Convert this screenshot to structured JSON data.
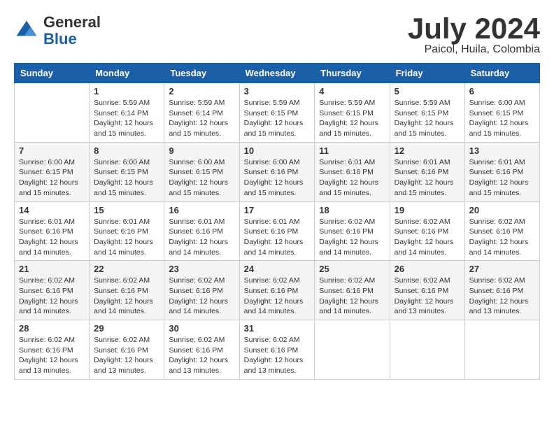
{
  "header": {
    "logo_general": "General",
    "logo_blue": "Blue",
    "title": "July 2024",
    "location": "Paicol, Huila, Colombia"
  },
  "weekdays": [
    "Sunday",
    "Monday",
    "Tuesday",
    "Wednesday",
    "Thursday",
    "Friday",
    "Saturday"
  ],
  "weeks": [
    [
      {
        "day": "",
        "sunrise": "",
        "sunset": "",
        "daylight": ""
      },
      {
        "day": "1",
        "sunrise": "Sunrise: 5:59 AM",
        "sunset": "Sunset: 6:14 PM",
        "daylight": "Daylight: 12 hours and 15 minutes."
      },
      {
        "day": "2",
        "sunrise": "Sunrise: 5:59 AM",
        "sunset": "Sunset: 6:14 PM",
        "daylight": "Daylight: 12 hours and 15 minutes."
      },
      {
        "day": "3",
        "sunrise": "Sunrise: 5:59 AM",
        "sunset": "Sunset: 6:15 PM",
        "daylight": "Daylight: 12 hours and 15 minutes."
      },
      {
        "day": "4",
        "sunrise": "Sunrise: 5:59 AM",
        "sunset": "Sunset: 6:15 PM",
        "daylight": "Daylight: 12 hours and 15 minutes."
      },
      {
        "day": "5",
        "sunrise": "Sunrise: 5:59 AM",
        "sunset": "Sunset: 6:15 PM",
        "daylight": "Daylight: 12 hours and 15 minutes."
      },
      {
        "day": "6",
        "sunrise": "Sunrise: 6:00 AM",
        "sunset": "Sunset: 6:15 PM",
        "daylight": "Daylight: 12 hours and 15 minutes."
      }
    ],
    [
      {
        "day": "7",
        "sunrise": "Sunrise: 6:00 AM",
        "sunset": "Sunset: 6:15 PM",
        "daylight": "Daylight: 12 hours and 15 minutes."
      },
      {
        "day": "8",
        "sunrise": "Sunrise: 6:00 AM",
        "sunset": "Sunset: 6:15 PM",
        "daylight": "Daylight: 12 hours and 15 minutes."
      },
      {
        "day": "9",
        "sunrise": "Sunrise: 6:00 AM",
        "sunset": "Sunset: 6:15 PM",
        "daylight": "Daylight: 12 hours and 15 minutes."
      },
      {
        "day": "10",
        "sunrise": "Sunrise: 6:00 AM",
        "sunset": "Sunset: 6:16 PM",
        "daylight": "Daylight: 12 hours and 15 minutes."
      },
      {
        "day": "11",
        "sunrise": "Sunrise: 6:01 AM",
        "sunset": "Sunset: 6:16 PM",
        "daylight": "Daylight: 12 hours and 15 minutes."
      },
      {
        "day": "12",
        "sunrise": "Sunrise: 6:01 AM",
        "sunset": "Sunset: 6:16 PM",
        "daylight": "Daylight: 12 hours and 15 minutes."
      },
      {
        "day": "13",
        "sunrise": "Sunrise: 6:01 AM",
        "sunset": "Sunset: 6:16 PM",
        "daylight": "Daylight: 12 hours and 15 minutes."
      }
    ],
    [
      {
        "day": "14",
        "sunrise": "Sunrise: 6:01 AM",
        "sunset": "Sunset: 6:16 PM",
        "daylight": "Daylight: 12 hours and 14 minutes."
      },
      {
        "day": "15",
        "sunrise": "Sunrise: 6:01 AM",
        "sunset": "Sunset: 6:16 PM",
        "daylight": "Daylight: 12 hours and 14 minutes."
      },
      {
        "day": "16",
        "sunrise": "Sunrise: 6:01 AM",
        "sunset": "Sunset: 6:16 PM",
        "daylight": "Daylight: 12 hours and 14 minutes."
      },
      {
        "day": "17",
        "sunrise": "Sunrise: 6:01 AM",
        "sunset": "Sunset: 6:16 PM",
        "daylight": "Daylight: 12 hours and 14 minutes."
      },
      {
        "day": "18",
        "sunrise": "Sunrise: 6:02 AM",
        "sunset": "Sunset: 6:16 PM",
        "daylight": "Daylight: 12 hours and 14 minutes."
      },
      {
        "day": "19",
        "sunrise": "Sunrise: 6:02 AM",
        "sunset": "Sunset: 6:16 PM",
        "daylight": "Daylight: 12 hours and 14 minutes."
      },
      {
        "day": "20",
        "sunrise": "Sunrise: 6:02 AM",
        "sunset": "Sunset: 6:16 PM",
        "daylight": "Daylight: 12 hours and 14 minutes."
      }
    ],
    [
      {
        "day": "21",
        "sunrise": "Sunrise: 6:02 AM",
        "sunset": "Sunset: 6:16 PM",
        "daylight": "Daylight: 12 hours and 14 minutes."
      },
      {
        "day": "22",
        "sunrise": "Sunrise: 6:02 AM",
        "sunset": "Sunset: 6:16 PM",
        "daylight": "Daylight: 12 hours and 14 minutes."
      },
      {
        "day": "23",
        "sunrise": "Sunrise: 6:02 AM",
        "sunset": "Sunset: 6:16 PM",
        "daylight": "Daylight: 12 hours and 14 minutes."
      },
      {
        "day": "24",
        "sunrise": "Sunrise: 6:02 AM",
        "sunset": "Sunset: 6:16 PM",
        "daylight": "Daylight: 12 hours and 14 minutes."
      },
      {
        "day": "25",
        "sunrise": "Sunrise: 6:02 AM",
        "sunset": "Sunset: 6:16 PM",
        "daylight": "Daylight: 12 hours and 14 minutes."
      },
      {
        "day": "26",
        "sunrise": "Sunrise: 6:02 AM",
        "sunset": "Sunset: 6:16 PM",
        "daylight": "Daylight: 12 hours and 13 minutes."
      },
      {
        "day": "27",
        "sunrise": "Sunrise: 6:02 AM",
        "sunset": "Sunset: 6:16 PM",
        "daylight": "Daylight: 12 hours and 13 minutes."
      }
    ],
    [
      {
        "day": "28",
        "sunrise": "Sunrise: 6:02 AM",
        "sunset": "Sunset: 6:16 PM",
        "daylight": "Daylight: 12 hours and 13 minutes."
      },
      {
        "day": "29",
        "sunrise": "Sunrise: 6:02 AM",
        "sunset": "Sunset: 6:16 PM",
        "daylight": "Daylight: 12 hours and 13 minutes."
      },
      {
        "day": "30",
        "sunrise": "Sunrise: 6:02 AM",
        "sunset": "Sunset: 6:16 PM",
        "daylight": "Daylight: 12 hours and 13 minutes."
      },
      {
        "day": "31",
        "sunrise": "Sunrise: 6:02 AM",
        "sunset": "Sunset: 6:16 PM",
        "daylight": "Daylight: 12 hours and 13 minutes."
      },
      {
        "day": "",
        "sunrise": "",
        "sunset": "",
        "daylight": ""
      },
      {
        "day": "",
        "sunrise": "",
        "sunset": "",
        "daylight": ""
      },
      {
        "day": "",
        "sunrise": "",
        "sunset": "",
        "daylight": ""
      }
    ]
  ]
}
